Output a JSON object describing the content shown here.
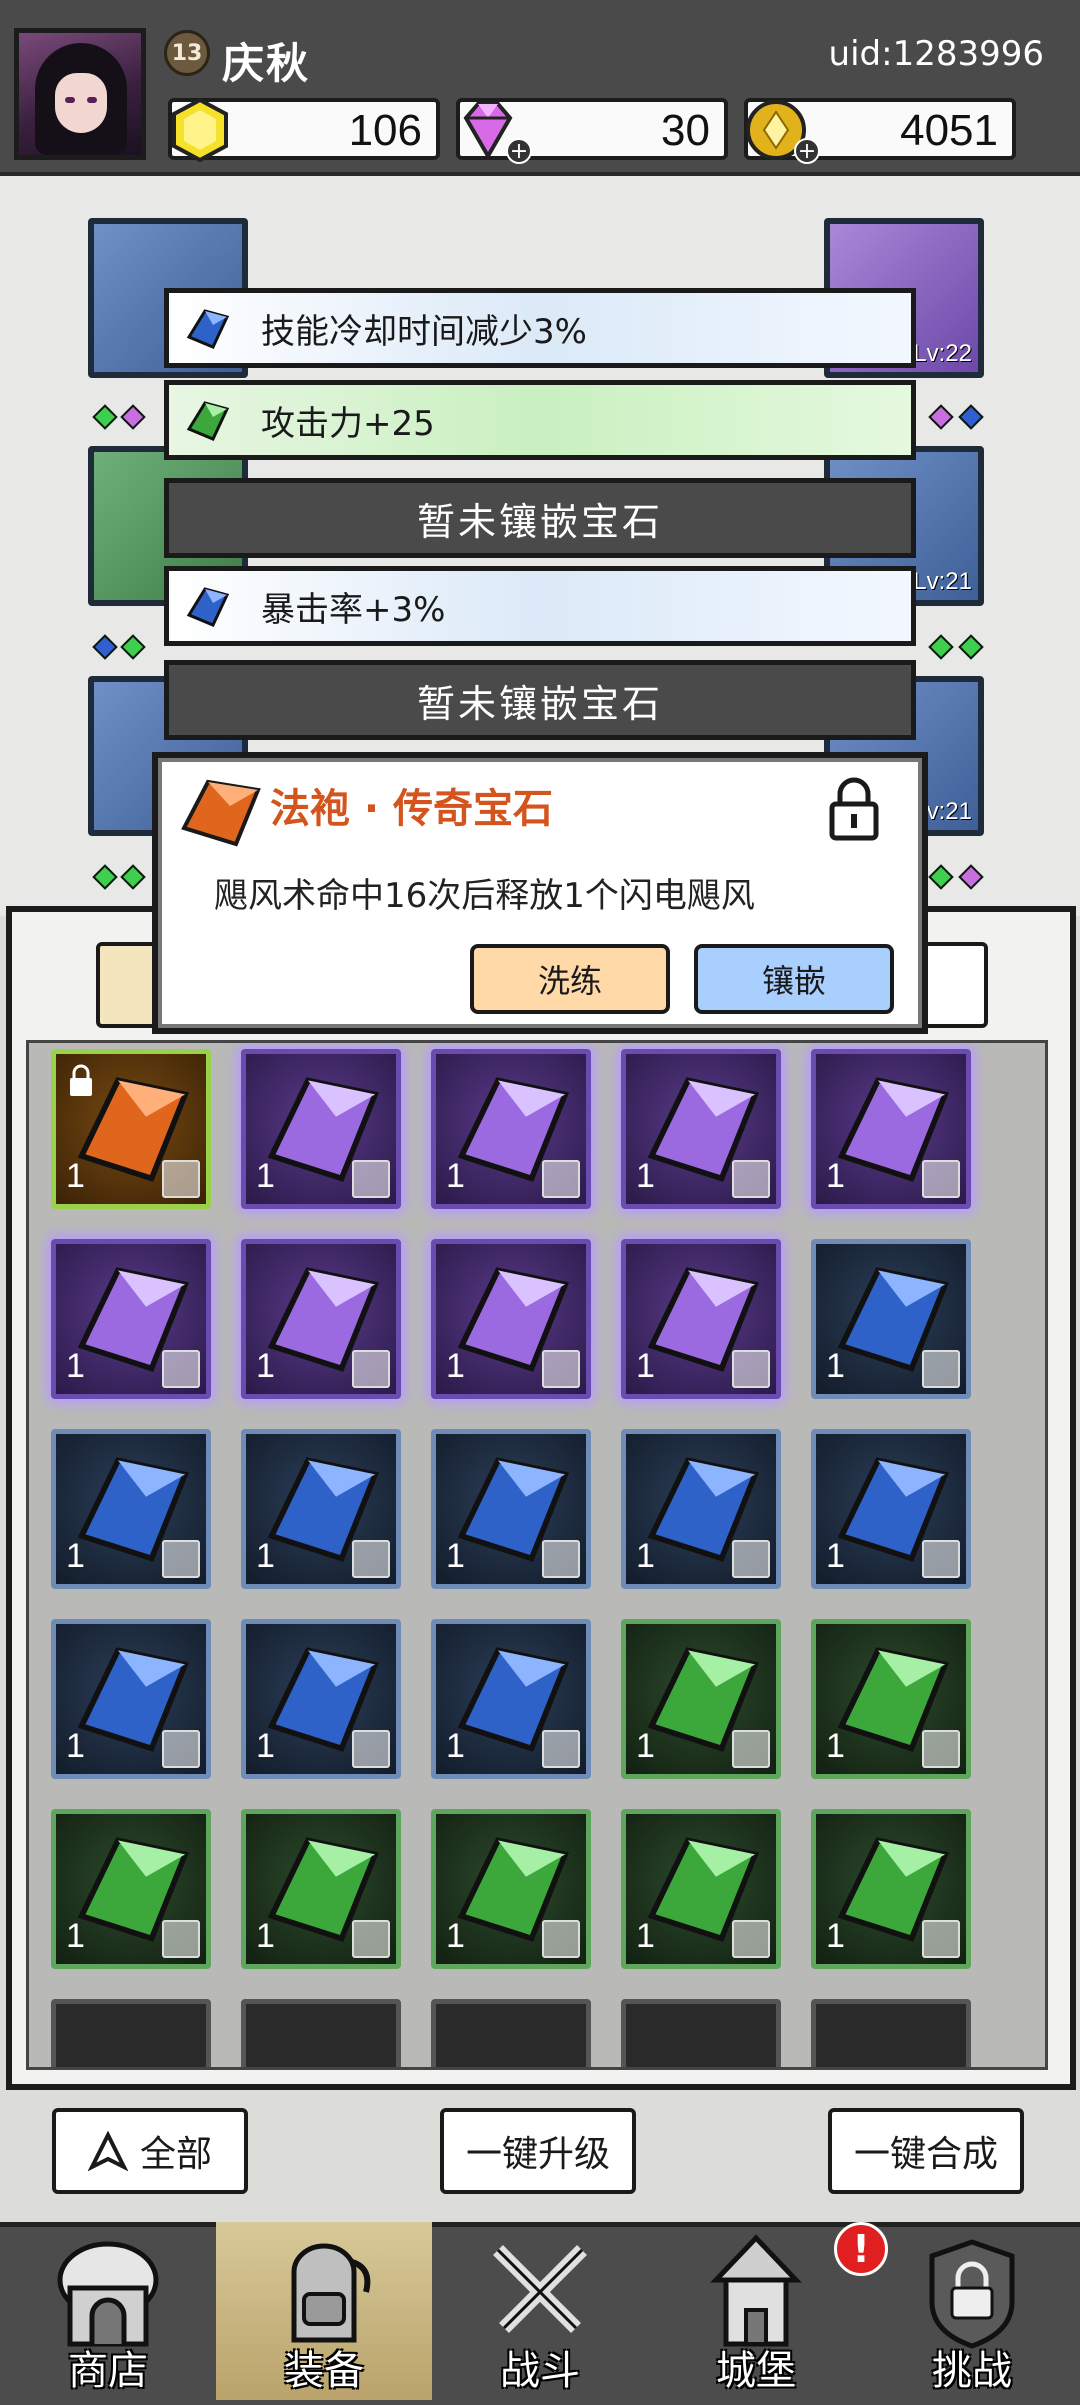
{
  "player": {
    "level": "13",
    "name": "庆秋",
    "uid": "uid:1283996"
  },
  "resources": {
    "gold": "106",
    "diamond": "30",
    "coin": "4051"
  },
  "equipment_levels": [
    "Lv:22",
    "Lv:21",
    "Lv:21"
  ],
  "gem_slots": [
    {
      "text": "技能冷却时间减少3%",
      "type": "blue"
    },
    {
      "text": "攻击力+25",
      "type": "green"
    },
    {
      "text": "暂未镶嵌宝石",
      "type": "empty"
    },
    {
      "text": "暴击率+3%",
      "type": "blue"
    },
    {
      "text": "暂未镶嵌宝石",
      "type": "empty"
    }
  ],
  "gem_detail": {
    "title": "法袍 · 传奇宝石",
    "description": "飓风术命中16次后释放1个闪电飓风",
    "wash_label": "洗练",
    "inlay_label": "镶嵌"
  },
  "inventory": {
    "rows": [
      [
        "orange",
        "purple",
        "purple",
        "purple",
        "purple"
      ],
      [
        "purple",
        "purple",
        "purple",
        "purple",
        "blue"
      ],
      [
        "blue",
        "blue",
        "blue",
        "blue",
        "blue"
      ],
      [
        "blue",
        "blue",
        "blue",
        "green",
        "green"
      ],
      [
        "green",
        "green",
        "green",
        "green",
        "green"
      ]
    ],
    "count": "1"
  },
  "actions": {
    "filter_all": "全部",
    "upgrade_all": "一键升级",
    "merge_all": "一键合成"
  },
  "nav": {
    "shop": "商店",
    "equipment": "装备",
    "battle": "战斗",
    "castle": "城堡",
    "challenge": "挑战",
    "alert": "!"
  },
  "colors": {
    "legendary_title": "#d3541d",
    "wash_button": "#ffd9a8",
    "inlay_button": "#a9cfff"
  }
}
